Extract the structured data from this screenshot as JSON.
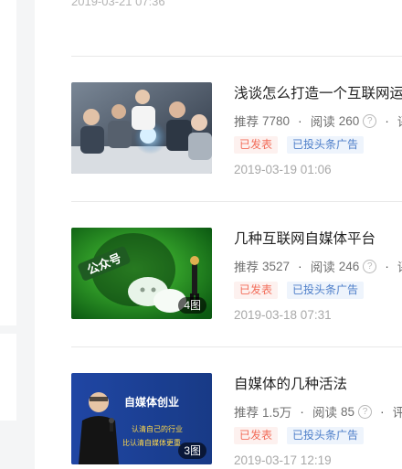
{
  "previous_item": {
    "date": "2019-03-21 07:36"
  },
  "articles": [
    {
      "title": "浅谈怎么打造一个互联网运",
      "recommend_label": "推荐",
      "recommend_value": "7780",
      "read_label": "阅读",
      "read_value": "260",
      "help_glyph": "?",
      "more_glyph": "评",
      "tags": [
        "已发表",
        "已投头条广告"
      ],
      "date": "2019-03-19 01:06",
      "image_count": "",
      "thumbnail_icon": "business-meeting-image"
    },
    {
      "title": "几种互联网自媒体平台",
      "recommend_label": "推荐",
      "recommend_value": "3527",
      "read_label": "阅读",
      "read_value": "246",
      "help_glyph": "?",
      "more_glyph": "评",
      "tags": [
        "已发表",
        "已投头条广告"
      ],
      "date": "2019-03-18 07:31",
      "image_count": "4图",
      "image_text": "公众号",
      "thumbnail_icon": "wechat-official-account-image"
    },
    {
      "title": "自媒体的几种活法",
      "recommend_label": "推荐",
      "recommend_value": "1.5万",
      "read_label": "阅读",
      "read_value": "85",
      "help_glyph": "?",
      "more_glyph": "评",
      "tags": [
        "已发表",
        "已投头条广告"
      ],
      "date": "2019-03-17 12:19",
      "image_count": "3图",
      "image_text_1": "自媒体创业",
      "image_text_2": "认清自己的行业",
      "image_text_3": "比认清自媒体更重",
      "thumbnail_icon": "speaker-on-stage-image"
    }
  ],
  "colors": {
    "published": "#f26d5a",
    "ads": "#4d7ec9"
  }
}
